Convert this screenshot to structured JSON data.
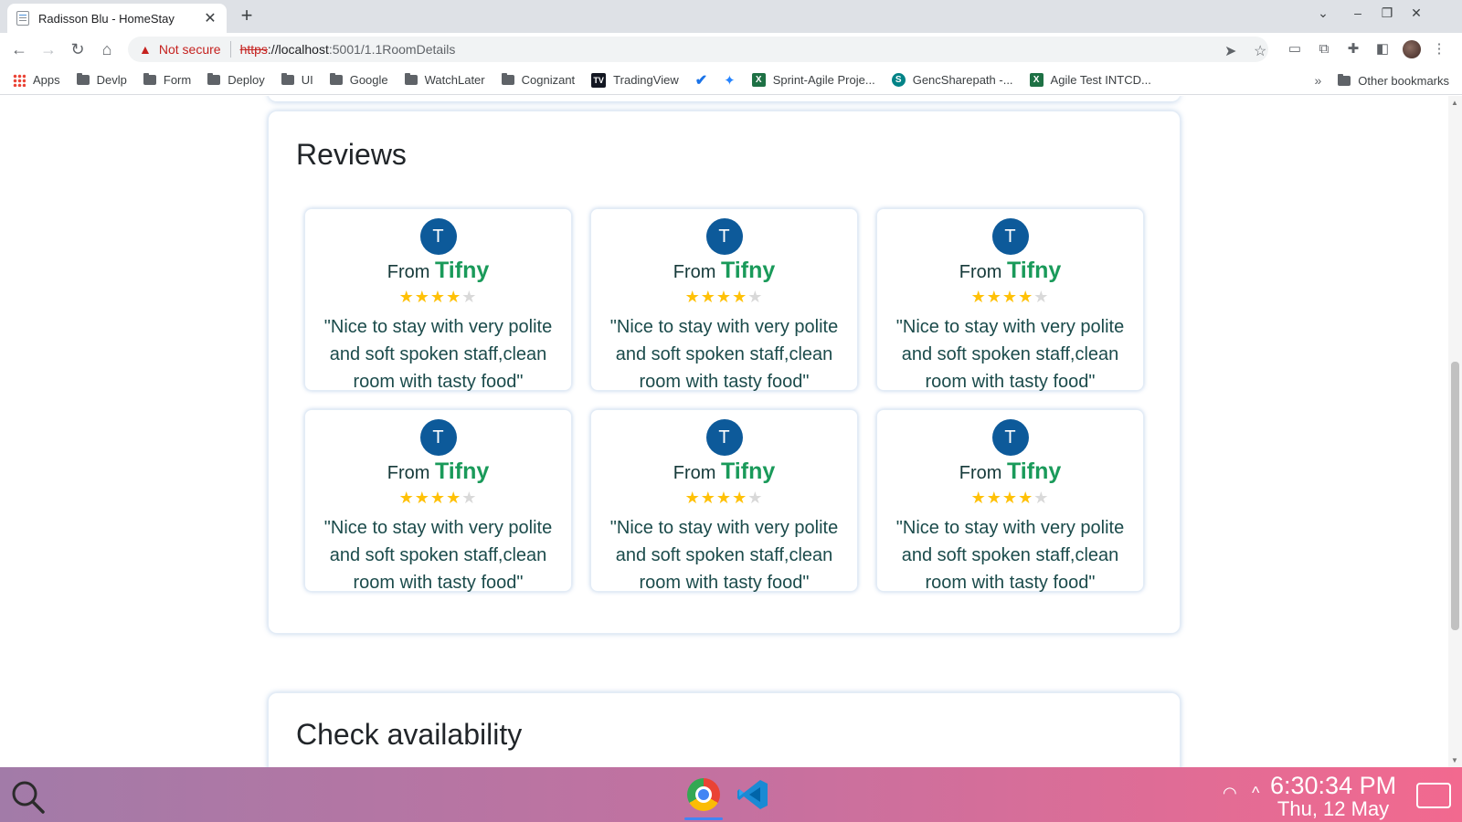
{
  "browser": {
    "tab_title": "Radisson Blu - HomeStay",
    "tab_close": "✕",
    "new_tab": "+",
    "window_controls": {
      "list": "⌄",
      "minimize": "–",
      "restore": "❐",
      "close": "✕"
    },
    "nav": {
      "back": "←",
      "forward": "→",
      "reload": "↻",
      "home": "⌂"
    },
    "security_icon": "▲",
    "security_text": "Not secure",
    "url_protocol": "https",
    "url_host": "://localhost",
    "url_rest": ":5001/1.1RoomDetails",
    "bookmarks": [
      {
        "label": "Apps",
        "icon": "apps-grid-icon"
      },
      {
        "label": "Devlp",
        "icon": "folder-icon"
      },
      {
        "label": "Form",
        "icon": "folder-icon"
      },
      {
        "label": "Deploy",
        "icon": "folder-icon"
      },
      {
        "label": "UI",
        "icon": "folder-icon"
      },
      {
        "label": "Google",
        "icon": "folder-icon"
      },
      {
        "label": "WatchLater",
        "icon": "folder-icon"
      },
      {
        "label": "Cognizant",
        "icon": "folder-icon"
      },
      {
        "label": "TradingView",
        "icon": "tradingview-icon",
        "badge": "TV"
      },
      {
        "label": "Sprint-Agile Proje...",
        "icon": "excel-icon",
        "badge": "X"
      },
      {
        "label": "GencSharepath -...",
        "icon": "sharepoint-icon",
        "badge": "S"
      },
      {
        "label": "Agile Test INTCD...",
        "icon": "excel-icon",
        "badge": "X"
      }
    ],
    "bookmarks_more": "»",
    "other_bookmarks": "Other bookmarks"
  },
  "page": {
    "reviews_title": "Reviews",
    "from_label": "From",
    "reviews": [
      {
        "avatar": "T",
        "name": "Tifny",
        "rating": 4,
        "max_rating": 5,
        "text": "\"Nice to stay with very polite and soft spoken staff,clean room with tasty food\""
      },
      {
        "avatar": "T",
        "name": "Tifny",
        "rating": 4,
        "max_rating": 5,
        "text": "\"Nice to stay with very polite and soft spoken staff,clean room with tasty food\""
      },
      {
        "avatar": "T",
        "name": "Tifny",
        "rating": 4,
        "max_rating": 5,
        "text": "\"Nice to stay with very polite and soft spoken staff,clean room with tasty food\""
      },
      {
        "avatar": "T",
        "name": "Tifny",
        "rating": 4,
        "max_rating": 5,
        "text": "\"Nice to stay with very polite and soft spoken staff,clean room with tasty food\""
      },
      {
        "avatar": "T",
        "name": "Tifny",
        "rating": 4,
        "max_rating": 5,
        "text": "\"Nice to stay with very polite and soft spoken staff,clean room with tasty food\""
      },
      {
        "avatar": "T",
        "name": "Tifny",
        "rating": 4,
        "max_rating": 5,
        "text": "\"Nice to stay with very polite and soft spoken staff,clean room with tasty food\""
      }
    ],
    "availability_title": "Check availability"
  },
  "taskbar": {
    "time": "6:30:34 PM",
    "date": "Thu, 12 May",
    "tray_up": "^"
  },
  "colors": {
    "accent_name": "#1a9a5a",
    "avatar_bg": "#0d5a9a",
    "star_on": "#ffc107",
    "star_off": "#d9d9d9"
  }
}
